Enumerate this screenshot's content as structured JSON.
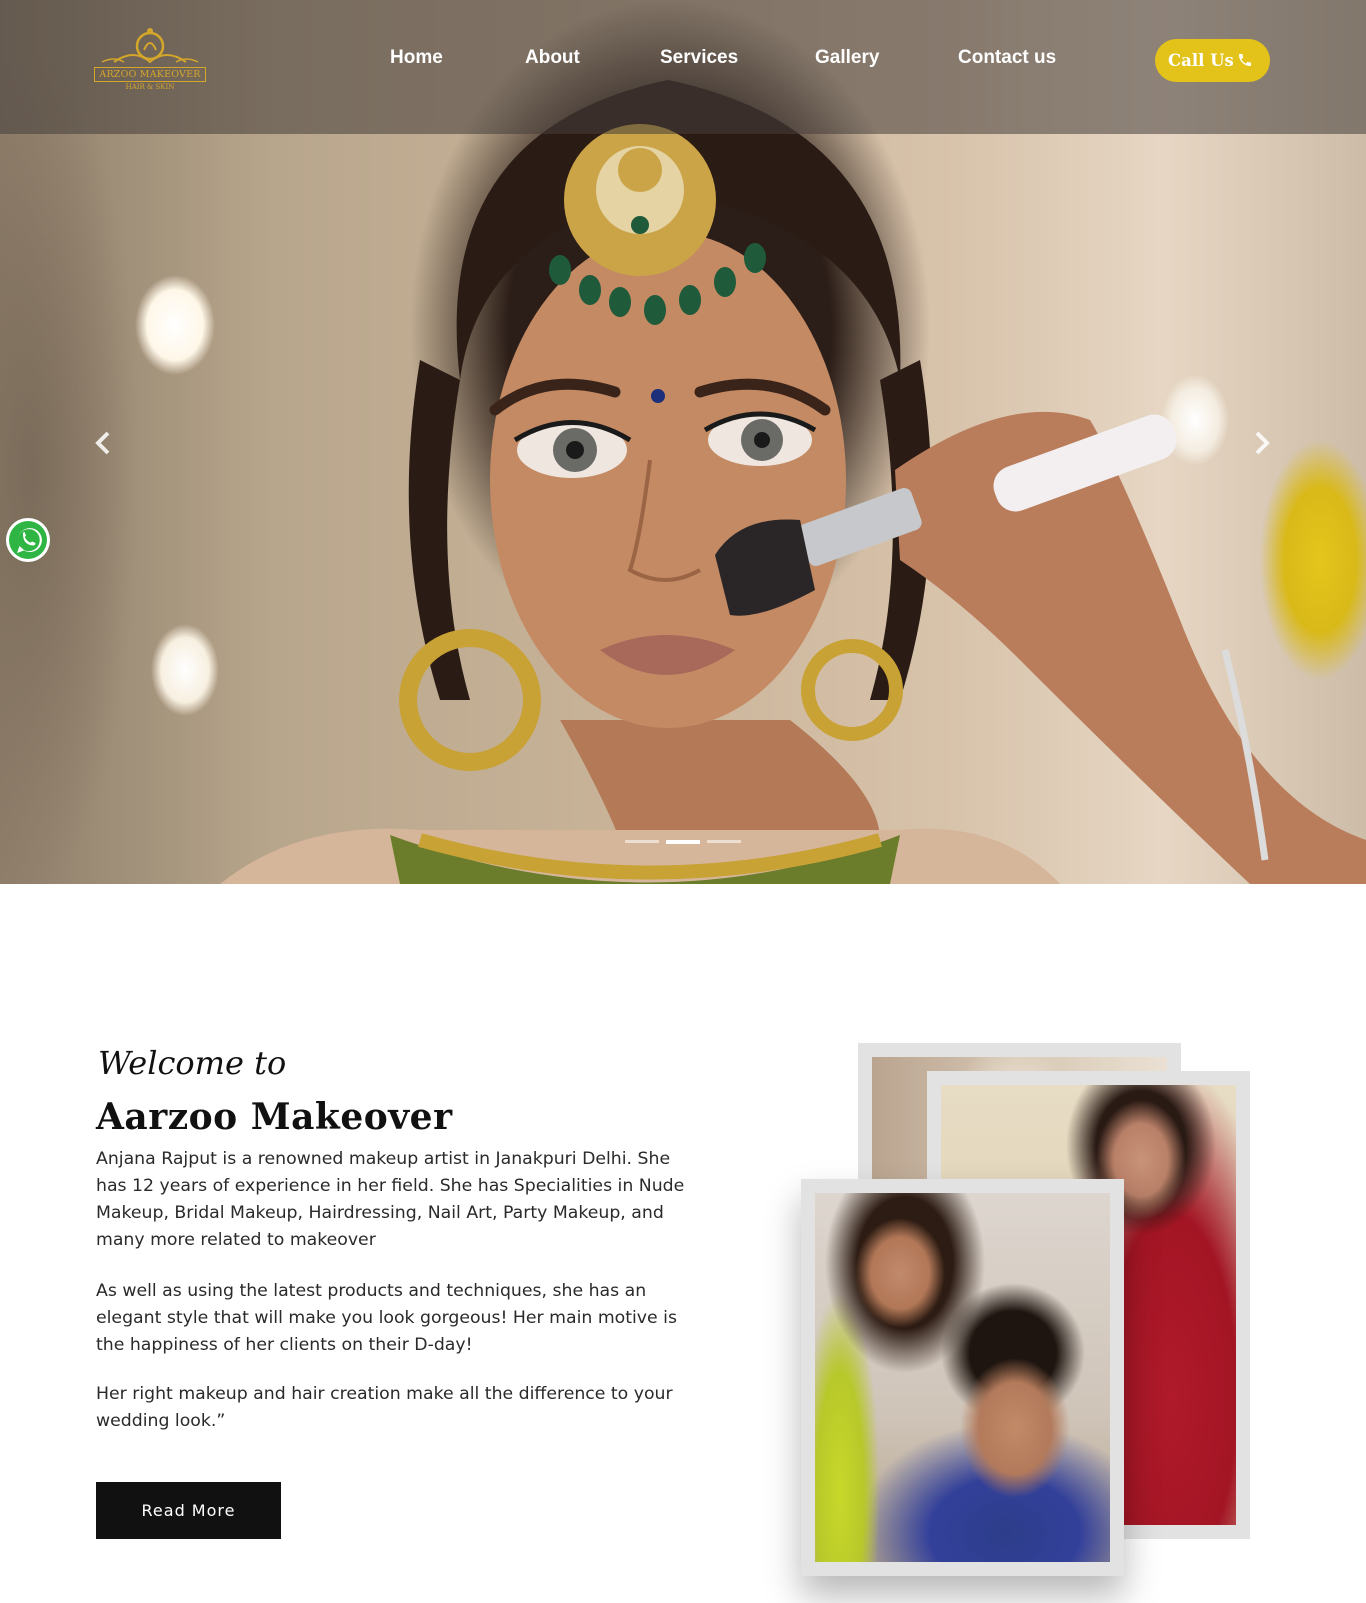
{
  "header": {
    "logo": {
      "line1": "ARZOO MAKEOVER",
      "line2": "HAIR & SKIN",
      "icon": "gold-crest-icon"
    },
    "nav": [
      {
        "label": "Home"
      },
      {
        "label": "About"
      },
      {
        "label": "Services"
      },
      {
        "label": "Gallery"
      },
      {
        "label": "Contact us"
      }
    ],
    "call_button": {
      "label": "Call Us",
      "icon": "phone-icon"
    }
  },
  "hero": {
    "prev_icon": "chevron-left-icon",
    "next_icon": "chevron-right-icon",
    "slides_count": 3,
    "active_slide": 2,
    "floating_icon": "whatsapp-icon"
  },
  "about": {
    "welcome": "Welcome to",
    "title": "Aarzoo Makeover",
    "paragraphs": [
      "Anjana Rajput is a renowned makeup artist in Janakpuri Delhi. She has 12 years of experience in her field. She has Specialities in Nude Makeup, Bridal Makeup, Hairdressing, Nail Art, Party Makeup, and many more related to makeover",
      "As well as using the latest products and techniques, she has an elegant style that will make you look gorgeous! Her main motive is the happiness of her clients on their D-day!",
      "Her right makeup and hair creation make all the difference to your wedding look.”"
    ],
    "read_more": "Read More"
  },
  "colors": {
    "accent": "#e3c21a",
    "gold": "#d4a62a",
    "button_dark": "#111111",
    "frame": "#e2e2e2"
  }
}
